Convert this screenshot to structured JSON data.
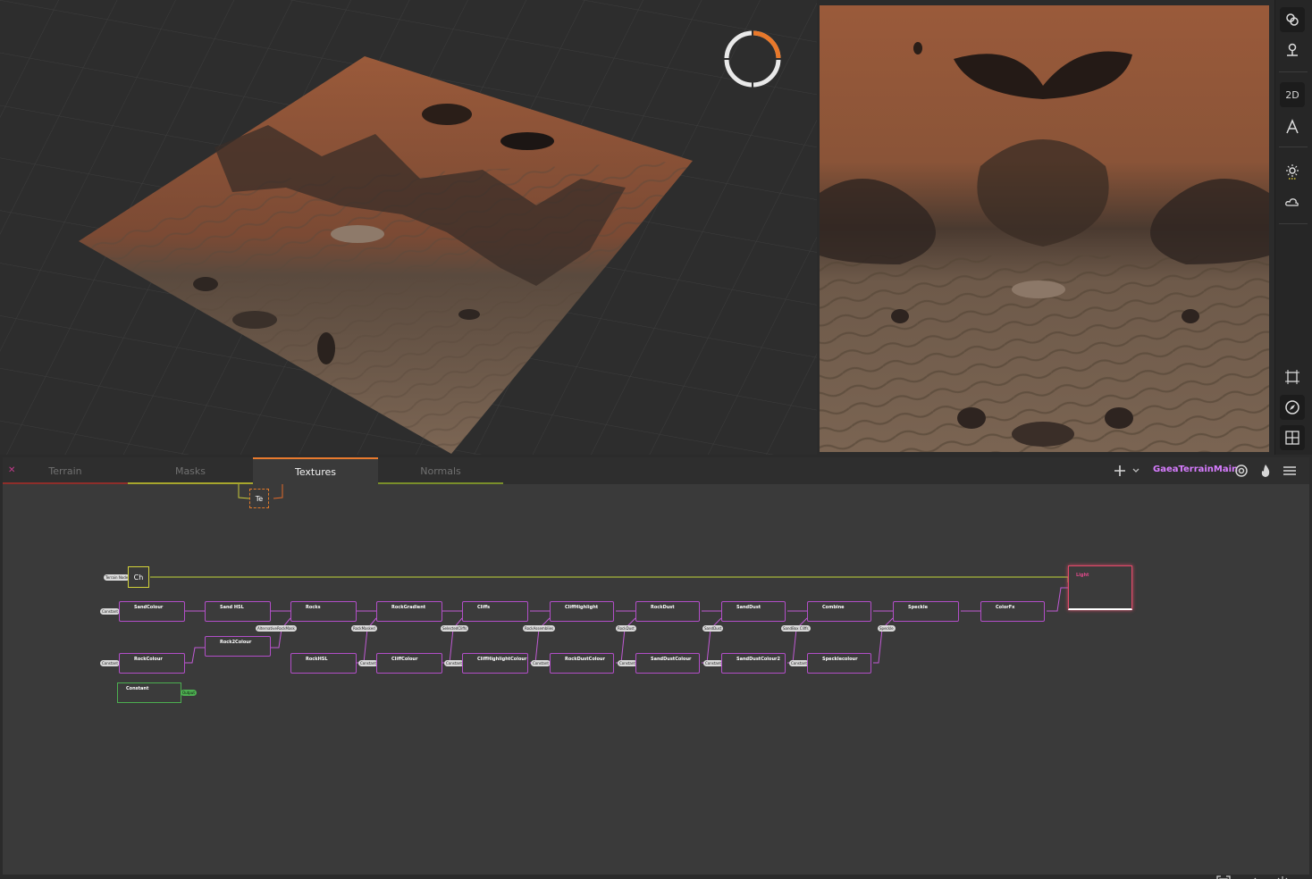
{
  "viewport_3d": {
    "compass_icon": "orbit-gizmo"
  },
  "right_toolbar": {
    "buttons": [
      {
        "icon": "link-icon"
      },
      {
        "icon": "pin-icon"
      },
      {
        "label": "2D"
      },
      {
        "icon": "text-icon"
      },
      {
        "icon": "sun-icon"
      },
      {
        "icon": "cloud-icon"
      },
      {
        "icon": "frame-icon"
      },
      {
        "icon": "compass-icon"
      },
      {
        "icon": "grid-icon"
      }
    ]
  },
  "graph": {
    "tabs": [
      {
        "label": "Terrain",
        "color": "#c0392b"
      },
      {
        "label": "Masks",
        "color": "#c9c93a"
      },
      {
        "label": "Textures",
        "color": "#e87a2e"
      },
      {
        "label": "Normals",
        "color": "#8aa02e"
      }
    ],
    "active_tab": "Textures",
    "graph_name": "GaeaTerrainMain",
    "top_node_label": "Te",
    "chain_node_label": "Ch",
    "chain_input_pill": "Terrain Node",
    "nodes_row1": [
      "SandColour",
      "Sand HSL",
      "Rocks",
      "RockGradient",
      "Cliffs",
      "CliffHighlight",
      "RockDust",
      "SandDust",
      "Combine",
      "Speckle",
      "ColorFx"
    ],
    "nodes_row2": [
      "Rock2Colour"
    ],
    "nodes_row3": [
      "RockColour",
      "RockHSL",
      "CliffColour",
      "CliffHighlightColour",
      "RockDustColour",
      "SandDustColour",
      "SandDustColour2",
      "Specklecolour"
    ],
    "output_node": "Light",
    "constant_node": "Constant",
    "constant_out_pill": "Output",
    "pills_row1": [
      "Constant"
    ],
    "pills_row2": [
      "AlternativeRockMask",
      "RockMasked",
      "SelectedCliffs",
      "RockAssemblies",
      "RockDust",
      "SandDust",
      "SandBox Cliffs",
      "Speckle"
    ],
    "pills_row3": [
      "Constant",
      "Constant",
      "Constant",
      "Constant",
      "Constant",
      "Constant",
      "Constant"
    ]
  },
  "bottom_icons": [
    "fit-icon",
    "refresh-icon",
    "layout-icon"
  ]
}
